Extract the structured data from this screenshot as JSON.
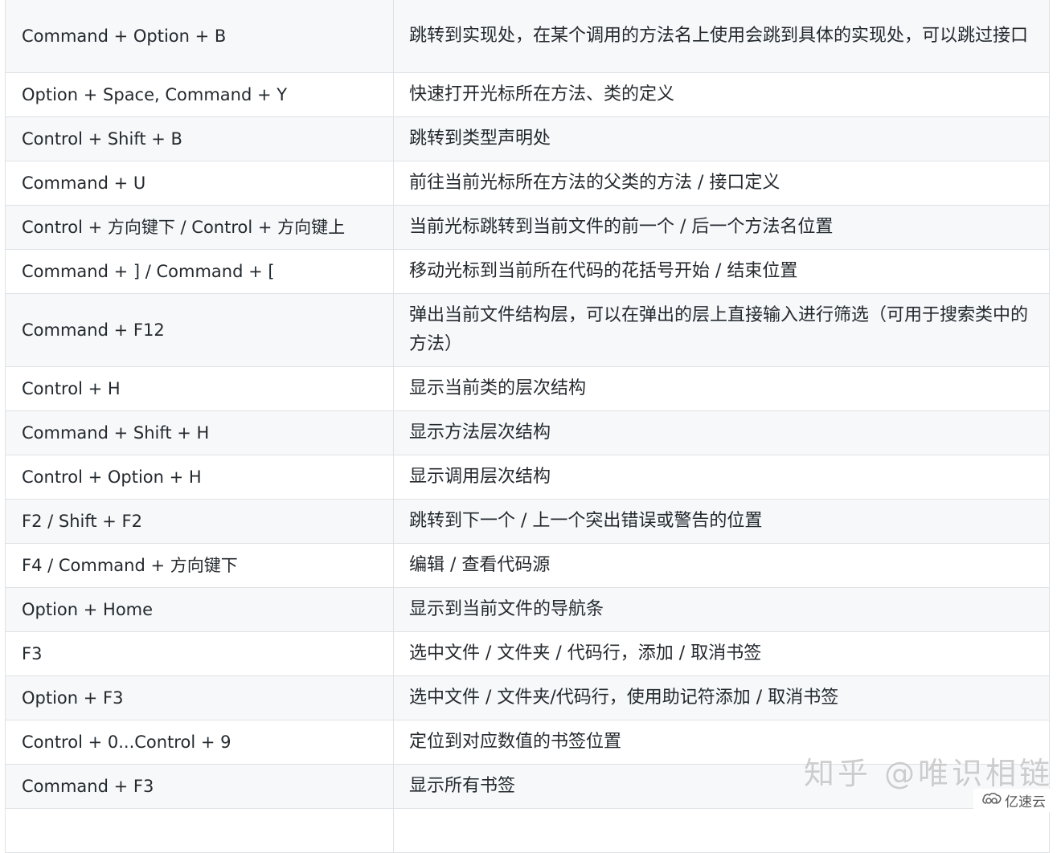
{
  "table": {
    "rows": [
      {
        "key": "Command + Option + B",
        "desc": "跳转到实现处，在某个调用的方法名上使用会跳到具体的实现处，可以跳过接口"
      },
      {
        "key": "Option + Space, Command + Y",
        "desc": "快速打开光标所在方法、类的定义"
      },
      {
        "key": "Control + Shift + B",
        "desc": "跳转到类型声明处"
      },
      {
        "key": "Command + U",
        "desc": "前往当前光标所在方法的父类的方法 / 接口定义"
      },
      {
        "key": "Control + 方向键下 / Control + 方向键上",
        "desc": "当前光标跳转到当前文件的前一个 / 后一个方法名位置"
      },
      {
        "key": "Command + ] / Command + [",
        "desc": "移动光标到当前所在代码的花括号开始 / 结束位置"
      },
      {
        "key": "Command + F12",
        "desc": "弹出当前文件结构层，可以在弹出的层上直接输入进行筛选（可用于搜索类中的方法）"
      },
      {
        "key": "Control + H",
        "desc": "显示当前类的层次结构"
      },
      {
        "key": "Command + Shift + H",
        "desc": "显示方法层次结构"
      },
      {
        "key": "Control + Option + H",
        "desc": "显示调用层次结构"
      },
      {
        "key": "F2 / Shift + F2",
        "desc": "跳转到下一个 / 上一个突出错误或警告的位置"
      },
      {
        "key": "F4 / Command + 方向键下",
        "desc": "编辑 / 查看代码源"
      },
      {
        "key": "Option + Home",
        "desc": "显示到当前文件的导航条"
      },
      {
        "key": "F3",
        "desc": "选中文件 / 文件夹 / 代码行，添加 / 取消书签"
      },
      {
        "key": "Option + F3",
        "desc": "选中文件 / 文件夹/代码行，使用助记符添加 / 取消书签"
      },
      {
        "key": "Control + 0...Control + 9",
        "desc": "定位到对应数值的书签位置"
      },
      {
        "key": "Command + F3",
        "desc": "显示所有书签"
      },
      {
        "key": "",
        "desc": ""
      }
    ]
  },
  "watermark": {
    "text": "知乎 @唯识相链"
  },
  "brand": {
    "icon": "cloud-logo-icon",
    "label": "亿速云"
  }
}
